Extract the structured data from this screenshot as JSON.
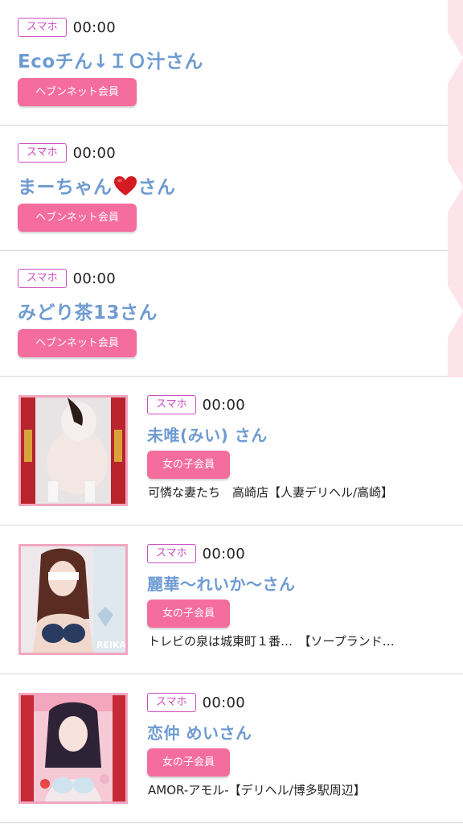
{
  "accent_colors": {
    "name_blue": "#6e9bd2",
    "badge_pink": "#f56d9d",
    "device_badge_purple": "#cc4fc0",
    "thumb_border": "#f0a7bf"
  },
  "members": [
    {
      "device": "スマホ",
      "time": "00:00",
      "name": "Ecoチん↓ＩＯ汁さん",
      "badge": "ヘブンネット会員"
    },
    {
      "device": "スマホ",
      "time": "00:00",
      "name_before": "まーちゃん",
      "name_icon": "red-heart-icon",
      "name_after": "さん",
      "badge": "ヘブンネット会員"
    },
    {
      "device": "スマホ",
      "time": "00:00",
      "name": "みどり茶13さん",
      "badge": "ヘブンネット会員"
    }
  ],
  "girls": [
    {
      "device": "スマホ",
      "time": "00:00",
      "name": "未唯(みい) さん",
      "badge": "女の子会員",
      "shop": "可憐な妻たち　高崎店【人妻デリヘル/高崎】"
    },
    {
      "device": "スマホ",
      "time": "00:00",
      "name": "麗華〜れいか〜さん",
      "badge": "女の子会員",
      "shop": "トレビの泉は城東町１番…　【ソープランド…",
      "thumb_text": "REIKA"
    },
    {
      "device": "スマホ",
      "time": "00:00",
      "name": "恋仲 めいさん",
      "badge": "女の子会員",
      "shop": "AMOR-アモル-【デリヘル/博多駅周辺】"
    }
  ]
}
